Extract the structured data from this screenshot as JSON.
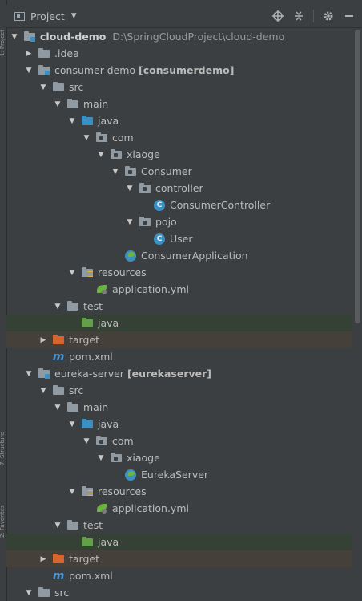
{
  "header": {
    "title": "Project"
  },
  "sidebar": {
    "tab1": "1: Project",
    "tab2": "7: Structure",
    "tab3": "2: Favorites"
  },
  "tree": [
    {
      "label": "cloud-demo",
      "extra": "D:\\SpringCloudProject\\cloud-demo",
      "icon": "module-folder-icon",
      "arrow": "down",
      "indent": 0,
      "bold": true
    },
    {
      "label": ".idea",
      "icon": "folder-icon",
      "arrow": "right",
      "indent": 1
    },
    {
      "label": "consumer-demo",
      "extra": "[consumerdemo]",
      "icon": "module-folder-icon",
      "arrow": "down",
      "indent": 1
    },
    {
      "label": "src",
      "icon": "folder-icon",
      "arrow": "down",
      "indent": 2
    },
    {
      "label": "main",
      "icon": "folder-icon",
      "arrow": "down",
      "indent": 3
    },
    {
      "label": "java",
      "icon": "source-folder-icon",
      "arrow": "down",
      "indent": 4
    },
    {
      "label": "com",
      "icon": "package-icon",
      "arrow": "down",
      "indent": 5
    },
    {
      "label": "xiaoge",
      "icon": "package-icon",
      "arrow": "down",
      "indent": 6
    },
    {
      "label": "Consumer",
      "icon": "package-icon",
      "arrow": "down",
      "indent": 7
    },
    {
      "label": "controller",
      "icon": "package-icon",
      "arrow": "down",
      "indent": 8
    },
    {
      "label": "ConsumerController",
      "icon": "class-icon",
      "arrow": "",
      "indent": 9
    },
    {
      "label": "pojo",
      "icon": "package-icon",
      "arrow": "down",
      "indent": 8
    },
    {
      "label": "User",
      "icon": "class-icon",
      "arrow": "",
      "indent": 9
    },
    {
      "label": "ConsumerApplication",
      "icon": "spring-boot-class-icon",
      "arrow": "",
      "indent": 7
    },
    {
      "label": "resources",
      "icon": "resources-folder-icon",
      "arrow": "down",
      "indent": 4
    },
    {
      "label": "application.yml",
      "icon": "spring-yml-icon",
      "arrow": "",
      "indent": 5
    },
    {
      "label": "test",
      "icon": "folder-icon",
      "arrow": "down",
      "indent": 3
    },
    {
      "label": "java",
      "icon": "test-folder-icon",
      "arrow": "",
      "indent": 4,
      "highlight": "green"
    },
    {
      "label": "target",
      "icon": "excluded-folder-icon",
      "arrow": "right",
      "indent": 2,
      "highlight": "brown"
    },
    {
      "label": "pom.xml",
      "icon": "maven-icon",
      "arrow": "",
      "indent": 2
    },
    {
      "label": "eureka-server",
      "extra": "[eurekaserver]",
      "icon": "module-folder-icon",
      "arrow": "down",
      "indent": 1
    },
    {
      "label": "src",
      "icon": "folder-icon",
      "arrow": "down",
      "indent": 2
    },
    {
      "label": "main",
      "icon": "folder-icon",
      "arrow": "down",
      "indent": 3
    },
    {
      "label": "java",
      "icon": "source-folder-icon",
      "arrow": "down",
      "indent": 4
    },
    {
      "label": "com",
      "icon": "package-icon",
      "arrow": "down",
      "indent": 5
    },
    {
      "label": "xiaoge",
      "icon": "package-icon",
      "arrow": "down",
      "indent": 6
    },
    {
      "label": "EurekaServer",
      "icon": "spring-boot-class-icon",
      "arrow": "",
      "indent": 7
    },
    {
      "label": "resources",
      "icon": "resources-folder-icon",
      "arrow": "down",
      "indent": 4
    },
    {
      "label": "application.yml",
      "icon": "spring-yml-icon",
      "arrow": "",
      "indent": 5
    },
    {
      "label": "test",
      "icon": "folder-icon",
      "arrow": "down",
      "indent": 3
    },
    {
      "label": "java",
      "icon": "test-folder-icon",
      "arrow": "",
      "indent": 4,
      "highlight": "green"
    },
    {
      "label": "target",
      "icon": "excluded-folder-icon",
      "arrow": "right",
      "indent": 2,
      "highlight": "brown"
    },
    {
      "label": "pom.xml",
      "icon": "maven-icon",
      "arrow": "",
      "indent": 2
    },
    {
      "label": "src",
      "icon": "folder-icon",
      "arrow": "down",
      "indent": 1
    }
  ]
}
